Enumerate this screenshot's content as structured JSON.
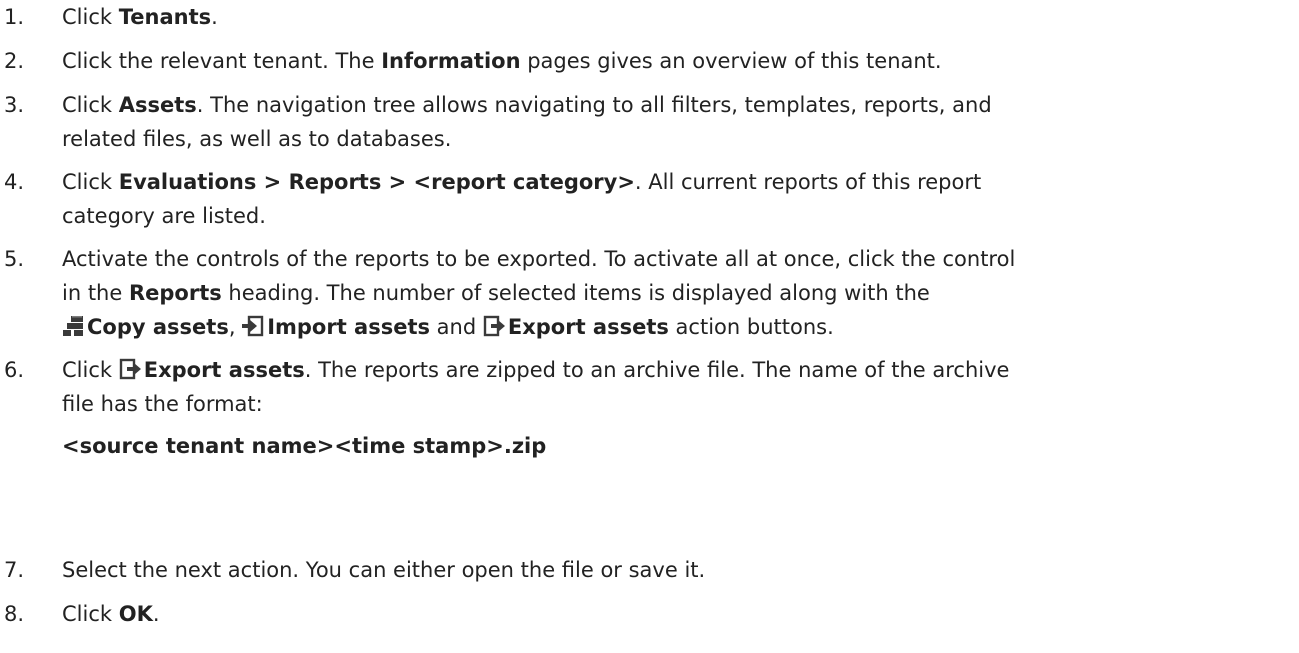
{
  "steps": [
    {
      "number": "1.",
      "lines": [
        {
          "a": "Click ",
          "b": "Tenants",
          "c": "."
        }
      ]
    },
    {
      "number": "2.",
      "lines": [
        {
          "a": "Click the relevant tenant. The ",
          "b": "Information",
          "c": " pages gives an overview of this tenant."
        }
      ]
    },
    {
      "number": "3.",
      "lines": [
        {
          "a": "Click ",
          "b": "Assets",
          "c": ". The navigation tree allows navigating to all filters, templates, reports, and"
        },
        {
          "a": "related files, as well as to databases."
        }
      ]
    },
    {
      "number": "4.",
      "lines": [
        {
          "a": "Click ",
          "b": "Evaluations > Reports > <report category>",
          "c": ". All current reports of this report"
        },
        {
          "a": "category are listed."
        }
      ]
    },
    {
      "number": "5.",
      "lines": [
        {
          "a": "Activate the controls of the reports to be exported. To activate all at once, click the control"
        },
        {
          "a": "in the ",
          "b": "Reports",
          "c": " heading. The number of selected items is displayed along with the"
        },
        {
          "copy": "Copy assets",
          "sep1": ", ",
          "import": "Import assets",
          "sep2": " and ",
          "export": "Export assets",
          "tail": " action buttons."
        }
      ]
    },
    {
      "number": "6.",
      "lines": [
        {
          "a": "Click ",
          "export": "Export assets",
          "c": ". The reports are zipped to an archive file. The name of the archive"
        },
        {
          "a": "file has the format:"
        },
        {
          "b": "<source tenant name><time stamp>.zip"
        }
      ]
    },
    {
      "number": "7.",
      "lines": [
        {
          "a": "Select the next action. You can either open the file or save it."
        }
      ]
    },
    {
      "number": "8.",
      "lines": [
        {
          "a": "Click ",
          "b": "OK",
          "c": "."
        }
      ]
    }
  ],
  "icons": {
    "copy": "copy-assets-icon",
    "import": "import-assets-icon",
    "export": "export-assets-icon"
  }
}
